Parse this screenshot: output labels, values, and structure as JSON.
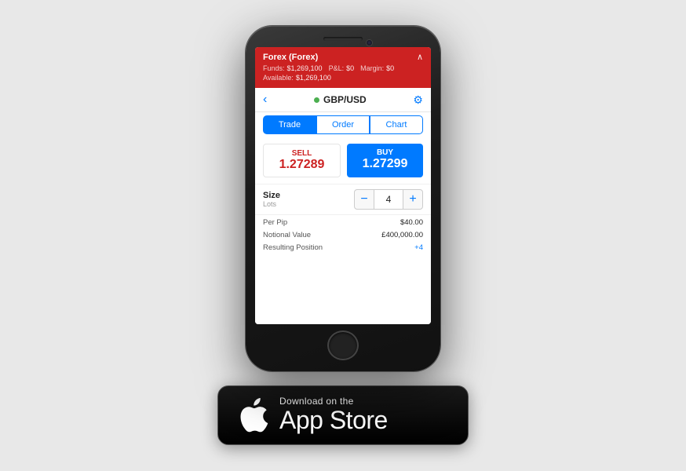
{
  "phone": {
    "header": {
      "title": "Forex (Forex)",
      "funds_label": "Funds:",
      "funds_value": "$1,269,100",
      "pl_label": "P&L:",
      "pl_value": "$0",
      "margin_label": "Margin:",
      "margin_value": "$0",
      "available_label": "Available:",
      "available_value": "$1,269,100"
    },
    "pair_bar": {
      "back_symbol": "‹",
      "pair_name": "GBP/USD",
      "settings_symbol": "⚙"
    },
    "tabs": [
      {
        "label": "Trade",
        "active": true
      },
      {
        "label": "Order",
        "active": false
      },
      {
        "label": "Chart",
        "active": false
      }
    ],
    "sell": {
      "label": "SELL",
      "price": "1.27289"
    },
    "buy": {
      "label": "BUY",
      "price": "1.27299"
    },
    "size": {
      "label": "Size",
      "sublabel": "Lots",
      "value": "4",
      "minus": "−",
      "plus": "+"
    },
    "details": [
      {
        "label": "Per Pip",
        "value": "$40.00",
        "positive": false
      },
      {
        "label": "Notional Value",
        "value": "£400,000.00",
        "positive": false
      },
      {
        "label": "Resulting Position",
        "value": "+4",
        "positive": true
      }
    ]
  },
  "appstore": {
    "sub_text": "Download on the",
    "main_text": "App Store"
  }
}
